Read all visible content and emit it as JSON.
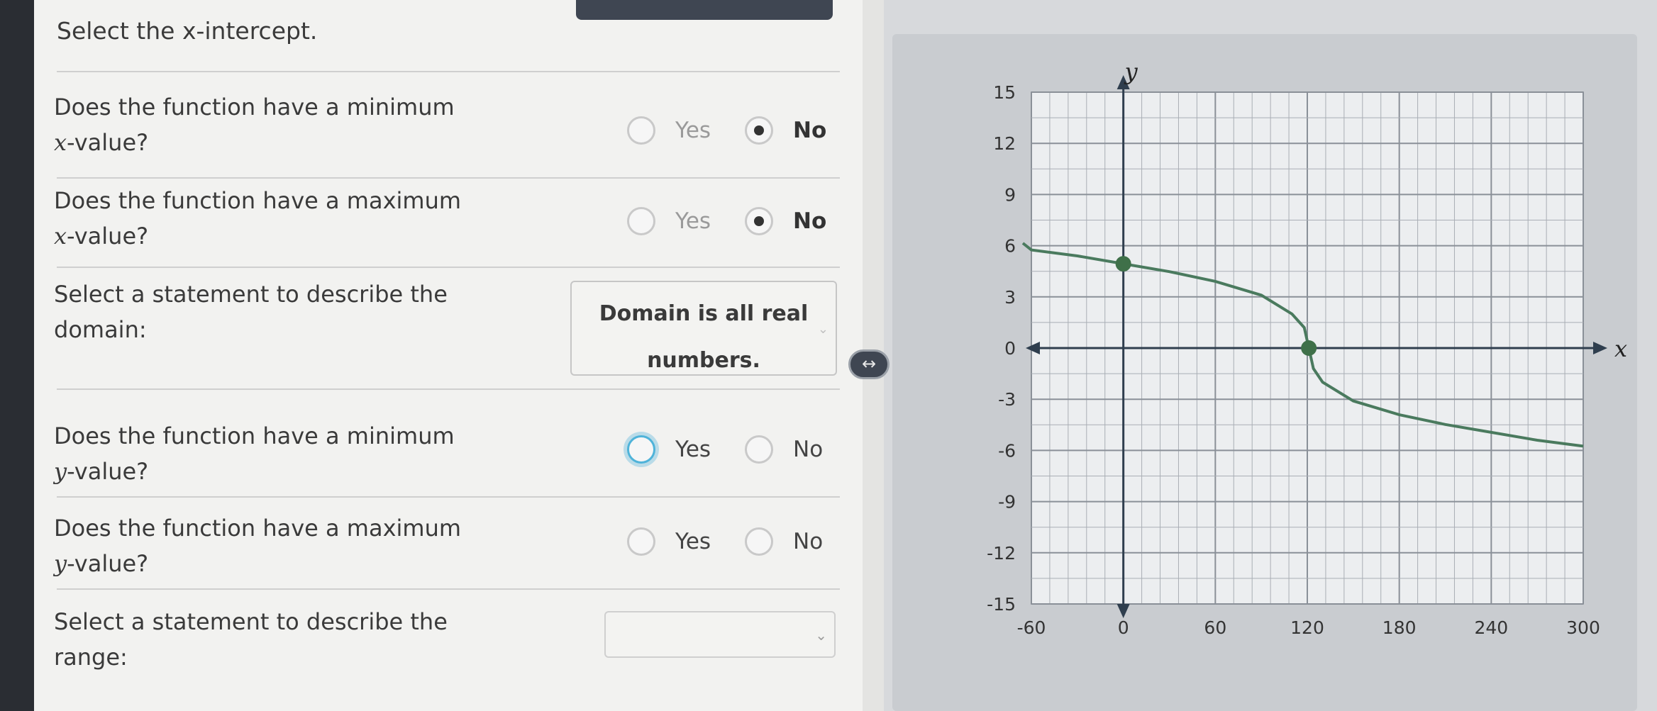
{
  "instruction": "Select the x-intercept.",
  "questions": {
    "min_x": {
      "text": "Does the function have a minimum",
      "var": "x",
      "suffix": "-value?",
      "yes": "Yes",
      "no": "No"
    },
    "max_x": {
      "text": "Does the function have a maximum",
      "var": "x",
      "suffix": "-value?",
      "yes": "Yes",
      "no": "No"
    },
    "domain": {
      "text1": "Select a statement to describe the",
      "text2": "domain:",
      "selected1": "Domain is all real",
      "selected2": "numbers."
    },
    "min_y": {
      "text": "Does the function have a minimum",
      "var": "y",
      "suffix": "-value?",
      "yes": "Yes",
      "no": "No"
    },
    "max_y": {
      "text": "Does the function have a maximum",
      "var": "y",
      "suffix": "-value?",
      "yes": "Yes",
      "no": "No"
    },
    "range": {
      "text1": "Select a statement to describe the",
      "text2": "range:"
    }
  },
  "icons": {
    "resize": "resize-horizontal-icon",
    "chevron": "chevron-down-icon"
  },
  "colors": {
    "curve": "#4a7a5e",
    "point": "#3f7049",
    "axis": "#2f3e4e",
    "grid": "#9aa0a8"
  },
  "chart_data": {
    "type": "line",
    "x_axis_label": "x",
    "y_axis_label": "y",
    "xlim": [
      -60,
      300
    ],
    "ylim": [
      -15,
      15
    ],
    "x_ticks": [
      -60,
      0,
      60,
      120,
      180,
      240,
      300
    ],
    "y_ticks": [
      15,
      12,
      9,
      6,
      3,
      0,
      -3,
      -6,
      -9,
      -12,
      -15
    ],
    "grid": true,
    "series": [
      {
        "x": [
          -100,
          -60,
          -30,
          0,
          30,
          60,
          90,
          110,
          118,
          121,
          124,
          130,
          150,
          180,
          210,
          240,
          270,
          300
        ],
        "y": [
          6.15,
          5.75,
          5.4,
          4.94,
          4.48,
          3.91,
          3.1,
          2.0,
          1.2,
          0,
          -1.2,
          -2.0,
          -3.1,
          -3.91,
          -4.48,
          -4.94,
          -5.4,
          -5.75
        ]
      }
    ],
    "points": [
      {
        "x": 0,
        "y": 4.94
      },
      {
        "x": 121,
        "y": 0
      }
    ]
  }
}
